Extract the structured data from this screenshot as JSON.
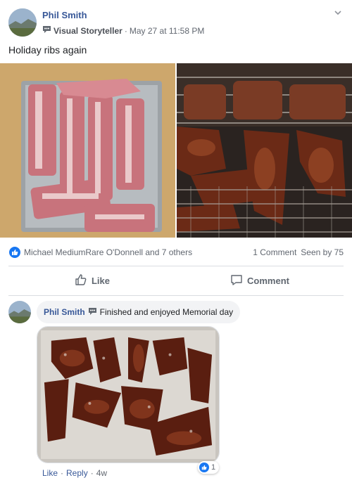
{
  "post": {
    "author": "Phil Smith",
    "badge_icon": "storyteller-badge-icon",
    "badge_label": "Visual Storyteller",
    "separator": "·",
    "timestamp": "May 27 at 11:58 PM",
    "text": "Holiday ribs again",
    "photos": [
      "raw ribs on cutting board",
      "ribs on smoker grill"
    ]
  },
  "reactions": {
    "names": "Michael MediumRare O'Donnell and 7 others",
    "comments": "1 Comment",
    "seen": "Seen by 75"
  },
  "actions": {
    "like_label": "Like",
    "comment_label": "Comment"
  },
  "comment": {
    "author": "Phil Smith",
    "text": "Finished and enjoyed Memorial day",
    "like_link": "Like",
    "reply_link": "Reply",
    "sep": "·",
    "age": "4w",
    "reaction_count": "1"
  },
  "colors": {
    "link_blue": "#385898",
    "like_blue": "#1877f2",
    "muted": "#616770"
  }
}
